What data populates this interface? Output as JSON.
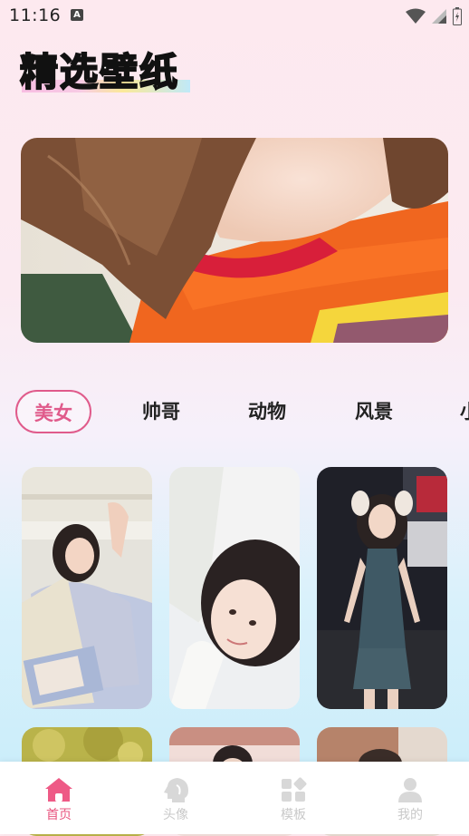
{
  "status_bar": {
    "time": "11:16",
    "notification_letter": "A"
  },
  "header": {
    "title": "精选壁纸"
  },
  "banner": {
    "alt": "wallpaper-banner"
  },
  "categories": {
    "items": [
      "美女",
      "帅哥",
      "动物",
      "风景",
      "小"
    ],
    "active_index": 0
  },
  "bottom_nav": {
    "items": [
      {
        "label": "首页",
        "icon": "home-icon",
        "active": true
      },
      {
        "label": "头像",
        "icon": "avatar-head-icon",
        "active": false
      },
      {
        "label": "模板",
        "icon": "template-grid-icon",
        "active": false
      },
      {
        "label": "我的",
        "icon": "profile-icon",
        "active": false
      }
    ]
  },
  "colors": {
    "accent": "#e05b8b",
    "nav_inactive": "#c9c9c9"
  }
}
